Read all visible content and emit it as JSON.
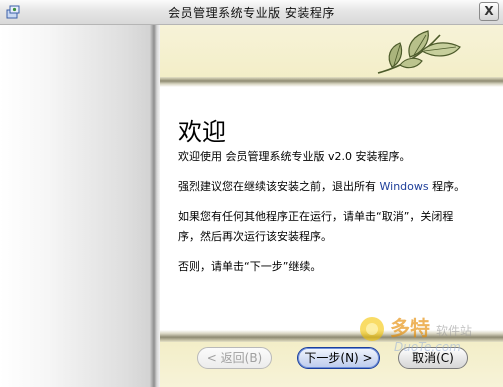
{
  "window": {
    "title": "会员管理系统专业版 安装程序",
    "close_label": "X"
  },
  "content": {
    "heading": "欢迎",
    "line1": "欢迎使用 会员管理系统专业版 v2.0 安装程序。",
    "line2_before": "强烈建议您在继续该安装之前，退出所有 ",
    "line2_highlight": "Windows",
    "line2_after": " 程序。",
    "line3a": "如果您有任何其他程序正在运行，请单击“取消”，关闭程",
    "line3b": "序，然后再次运行该安装程序。",
    "line4": "否则，请单击“下一步”继续。"
  },
  "buttons": {
    "back": "< 返回(B)",
    "next": "下一步(N) >",
    "cancel": "取消(C)"
  },
  "colors": {
    "accent": "#1f3f9a",
    "banner": "#f5f0cf"
  },
  "icons": {
    "title": "installer-icon",
    "banner": "leaf-icon"
  }
}
